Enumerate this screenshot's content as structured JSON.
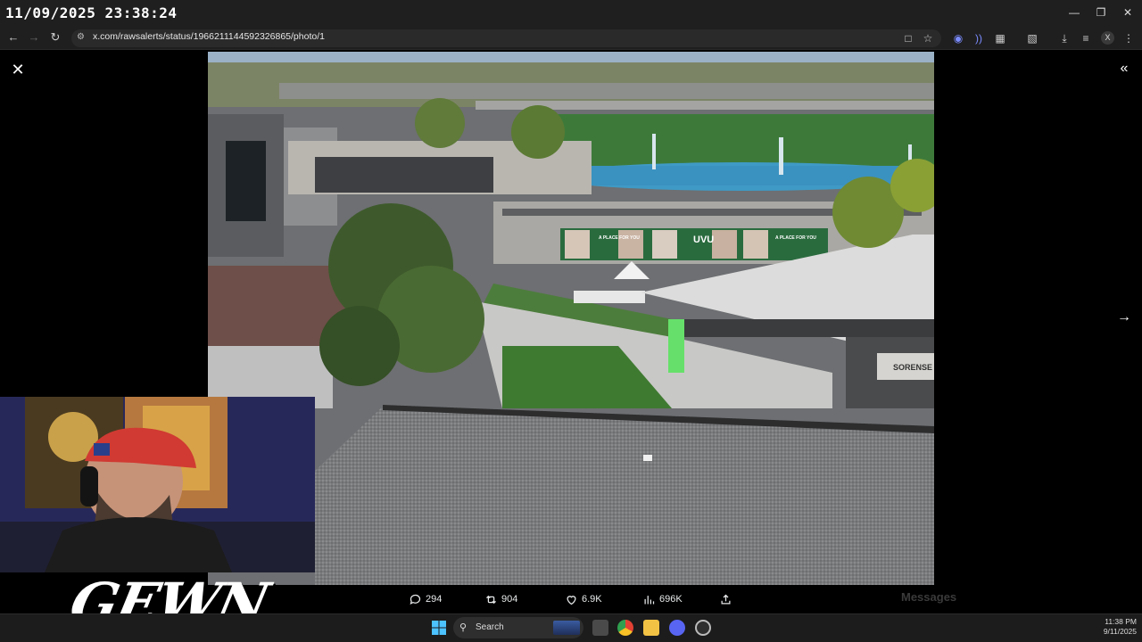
{
  "overlay": {
    "timestamp": "11/09/2025 23:38:24"
  },
  "browser": {
    "url": "x.com/rawsalerts/status/1966211144592326865/photo/1",
    "profile_initial": "X"
  },
  "post_actions": {
    "replies": "294",
    "reposts": "904",
    "likes": "6.9K",
    "views": "696K"
  },
  "photo_signs": {
    "uvu": "UVU",
    "banner": "A PLACE FOR YOU",
    "building": "SORENSE"
  },
  "ghost_panel": {
    "messages": "Messages"
  },
  "stream": {
    "logo": "GEWN"
  },
  "taskbar": {
    "search_placeholder": "Search",
    "time": "11:38 PM",
    "date": "9/11/2025"
  },
  "colors": {
    "chrome": "#1f1f1f",
    "taskbar": "#1c1c1c",
    "accent_blue": "#1d9bf0"
  }
}
